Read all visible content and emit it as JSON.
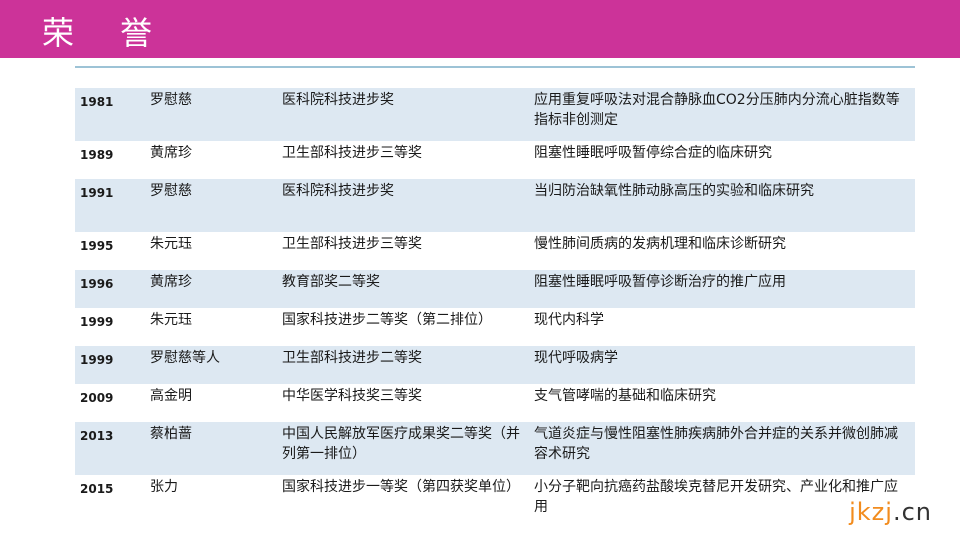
{
  "header": {
    "title": "荣 誉"
  },
  "rows": [
    {
      "year": "1981",
      "name": "罗慰慈",
      "award": "医科院科技进步奖",
      "project": "应用重复呼吸法对混合静脉血CO2分压肺内分流心脏指数等指标非创测定"
    },
    {
      "year": "1989",
      "name": "黄席珍",
      "award": "卫生部科技进步三等奖",
      "project": "阻塞性睡眠呼吸暂停综合症的临床研究"
    },
    {
      "year": "1991",
      "name": "罗慰慈",
      "award": "医科院科技进步奖",
      "project": "当归防治缺氧性肺动脉高压的实验和临床研究"
    },
    {
      "year": "1995",
      "name": "朱元珏",
      "award": "卫生部科技进步三等奖",
      "project": "慢性肺间质病的发病机理和临床诊断研究"
    },
    {
      "year": "1996",
      "name": "黄席珍",
      "award": "教育部奖二等奖",
      "project": "阻塞性睡眠呼吸暂停诊断治疗的推广应用"
    },
    {
      "year": "1999",
      "name": "朱元珏",
      "award": "国家科技进步二等奖（第二排位）",
      "project": "现代内科学"
    },
    {
      "year": "1999",
      "name": "罗慰慈等人",
      "award": "卫生部科技进步二等奖",
      "project": "现代呼吸病学"
    },
    {
      "year": "2009",
      "name": "高金明",
      "award": "中华医学科技奖三等奖",
      "project": "支气管哮喘的基础和临床研究"
    },
    {
      "year": "2013",
      "name": "蔡柏蔷",
      "award": "中国人民解放军医疗成果奖二等奖（并列第一排位）",
      "project": "气道炎症与慢性阻塞性肺疾病肺外合并症的关系并微创肺减容术研究"
    },
    {
      "year": "2015",
      "name": "张力",
      "award": "国家科技进步一等奖（第四获奖单位）",
      "project": "小分子靶向抗癌药盐酸埃克替尼开发研究、产业化和推广应用"
    }
  ],
  "logo": {
    "part1": "jkzj",
    "part2": ".cn"
  },
  "colors": {
    "header": "#cc3399",
    "row_shade": "#dde8f2",
    "rule": "#9dc3d6",
    "logo_orange": "#f28c1e"
  }
}
